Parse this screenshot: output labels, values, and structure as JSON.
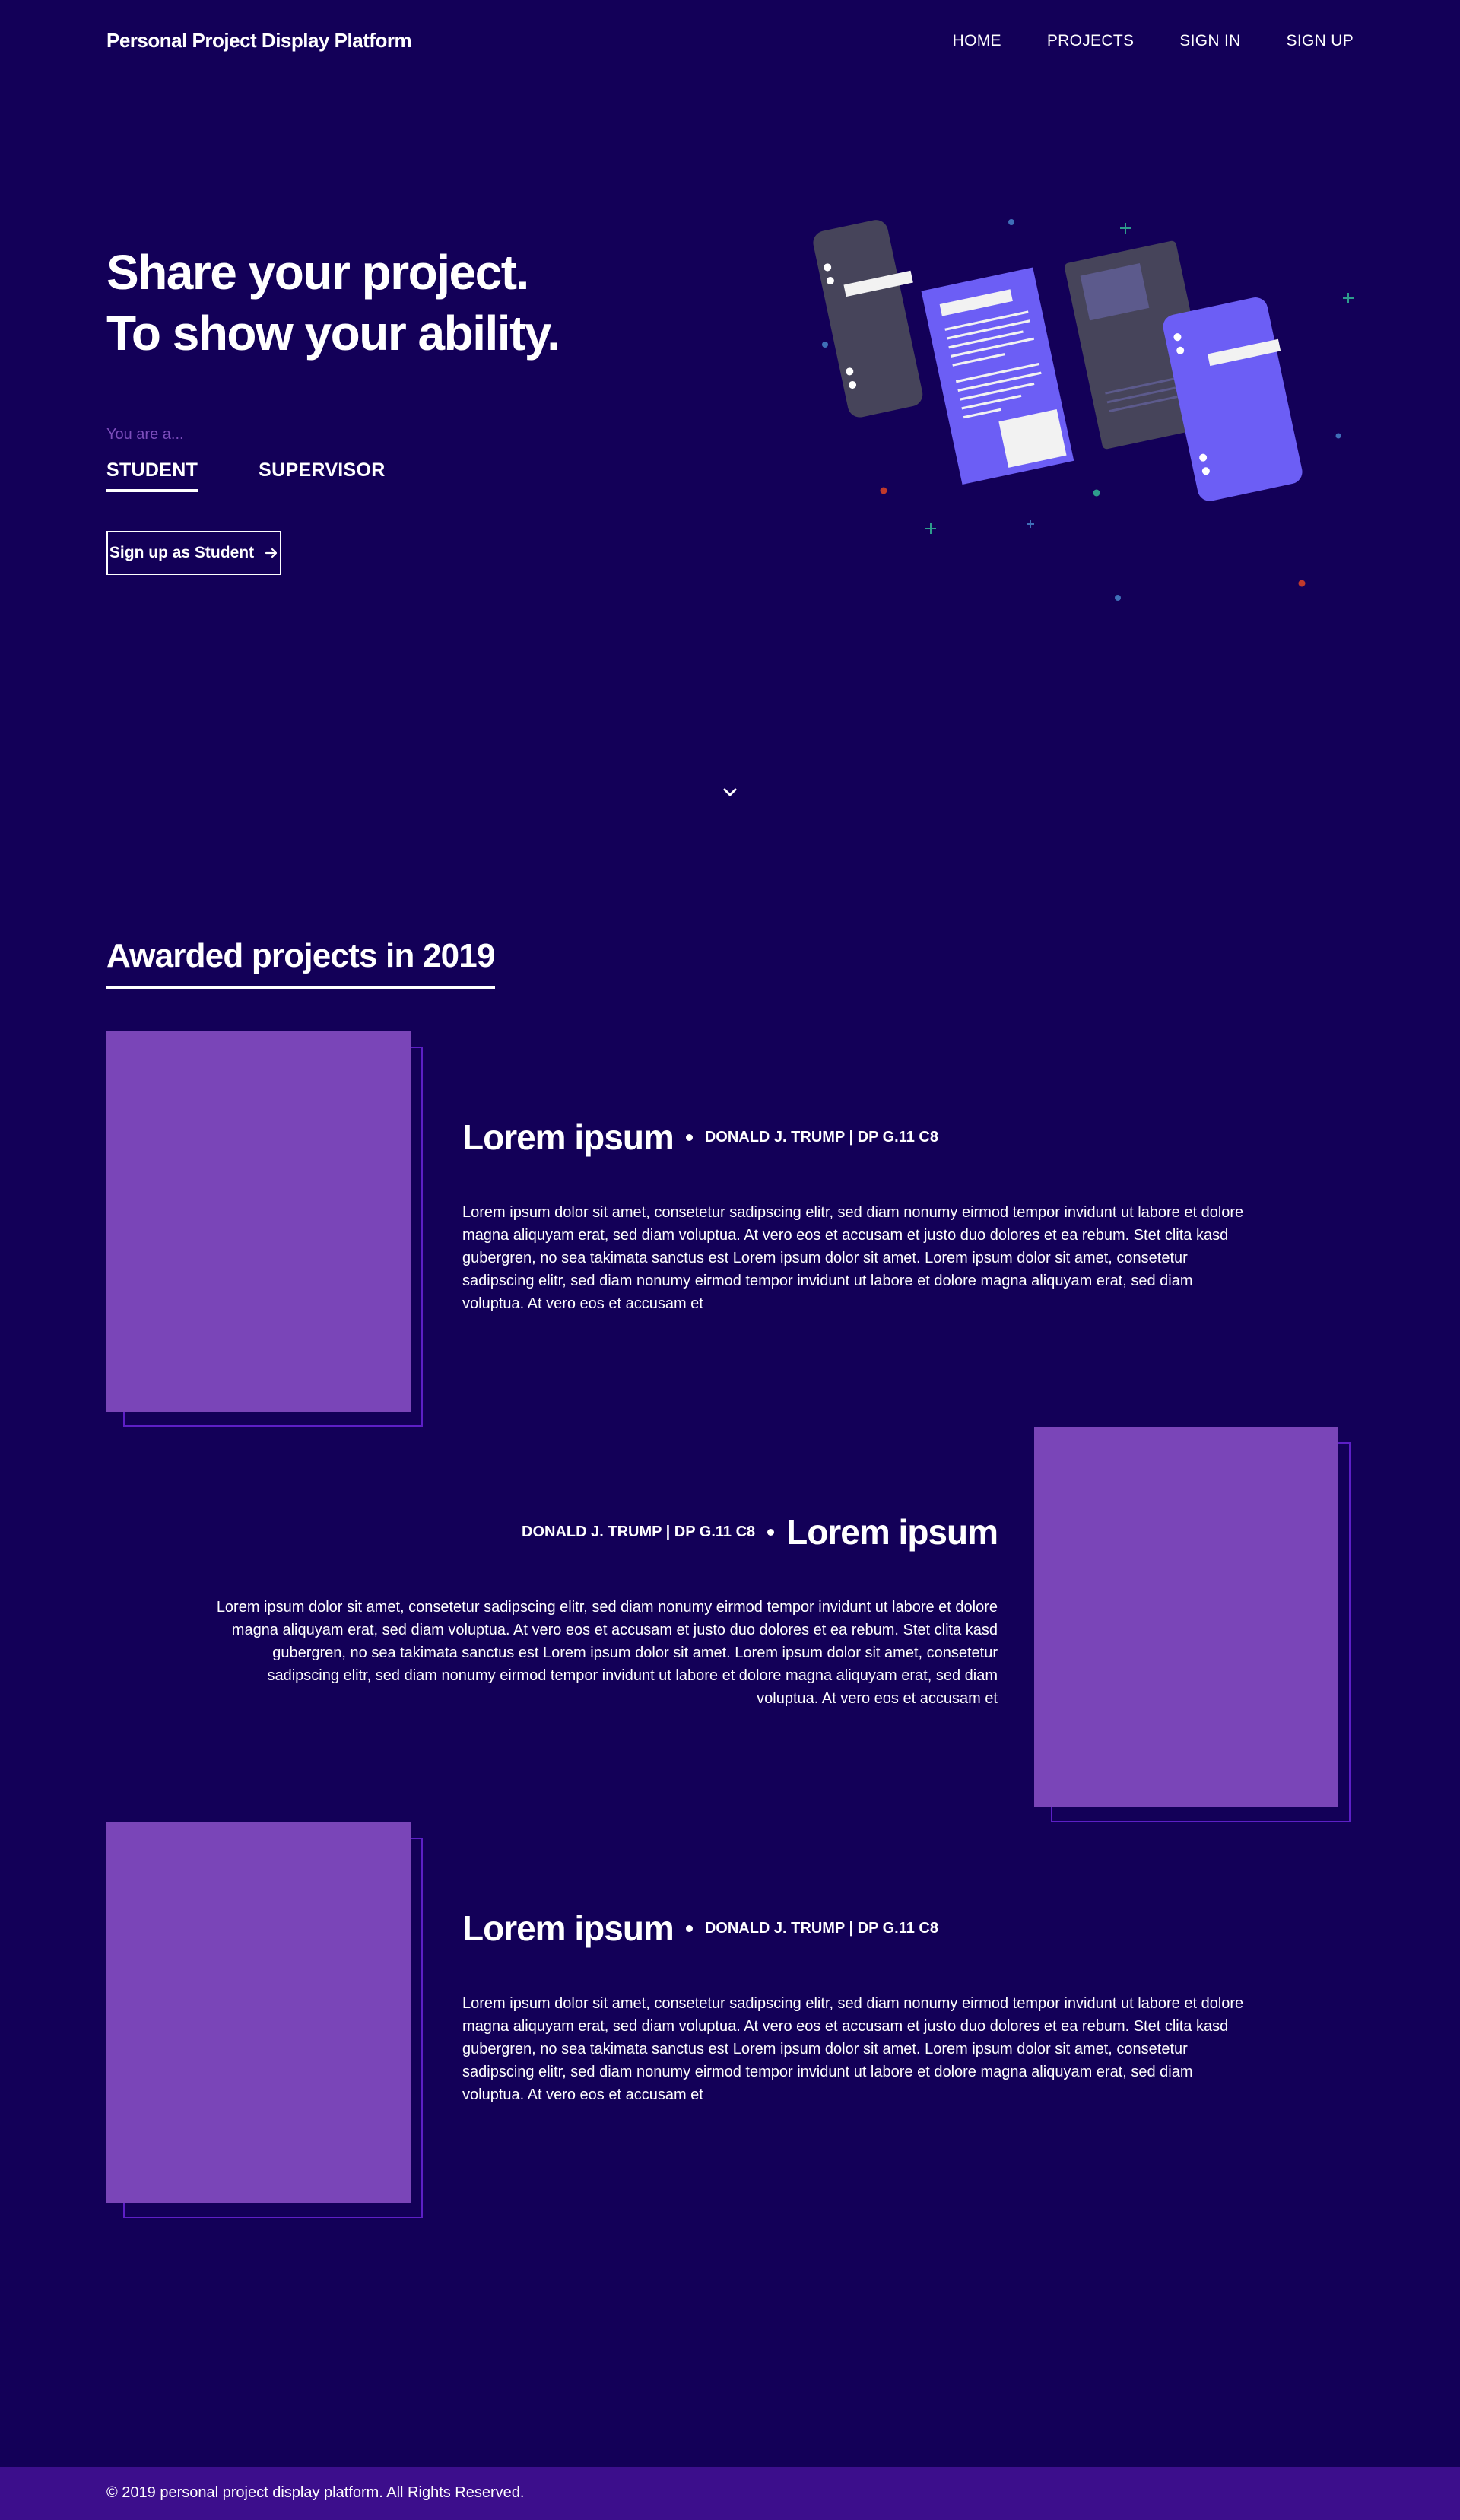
{
  "header": {
    "brand": "Personal Project Display Platform",
    "nav": [
      "HOME",
      "PROJECTS",
      "SIGN IN",
      "SIGN UP"
    ]
  },
  "hero": {
    "title_line1": "Share your project.",
    "title_line2": "To show your ability.",
    "you_are": "You are a...",
    "roles": [
      "STUDENT",
      "SUPERVISOR"
    ],
    "active_role": "STUDENT",
    "cta": "Sign up as Student"
  },
  "awarded": {
    "title": "Awarded projects in 2019",
    "projects": [
      {
        "title": "Lorem ipsum",
        "meta": "DONALD J. TRUMP | DP G.11 C8",
        "description": "Lorem ipsum dolor sit amet, consetetur sadipscing elitr, sed diam nonumy eirmod tempor invidunt ut labore et dolore magna aliquyam erat, sed diam voluptua. At vero eos et accusam et justo duo dolores et ea rebum. Stet clita kasd gubergren, no sea takimata sanctus est Lorem ipsum dolor sit amet. Lorem ipsum dolor sit amet, consetetur sadipscing elitr, sed diam nonumy eirmod tempor invidunt ut labore et dolore magna aliquyam erat, sed diam voluptua. At vero eos et accusam et"
      },
      {
        "title": "Lorem ipsum",
        "meta": "DONALD J. TRUMP | DP G.11 C8",
        "description": "Lorem ipsum dolor sit amet, consetetur sadipscing elitr, sed diam nonumy eirmod tempor invidunt ut labore et dolore magna aliquyam erat, sed diam voluptua. At vero eos et accusam et justo duo dolores et ea rebum. Stet clita kasd gubergren, no sea takimata sanctus est Lorem ipsum dolor sit amet. Lorem ipsum dolor sit amet, consetetur sadipscing elitr, sed diam nonumy eirmod tempor invidunt ut labore et dolore magna aliquyam erat, sed diam voluptua. At vero eos et accusam et"
      },
      {
        "title": "Lorem ipsum",
        "meta": "DONALD J. TRUMP | DP G.11 C8",
        "description": "Lorem ipsum dolor sit amet, consetetur sadipscing elitr, sed diam nonumy eirmod tempor invidunt ut labore et dolore magna aliquyam erat, sed diam voluptua. At vero eos et accusam et justo duo dolores et ea rebum. Stet clita kasd gubergren, no sea takimata sanctus est Lorem ipsum dolor sit amet. Lorem ipsum dolor sit amet, consetetur sadipscing elitr, sed diam nonumy eirmod tempor invidunt ut labore et dolore magna aliquyam erat, sed diam voluptua. At vero eos et accusam et"
      }
    ]
  },
  "footer": {
    "copyright": "© 2019 personal project display platform. All Rights Reserved."
  },
  "colors": {
    "background": "#130058",
    "accent_purple": "#7a45b8",
    "card_outline": "#5d1fc6",
    "illustration_blue": "#6c5ef5",
    "illustration_grey": "#46445a",
    "footer": "#3c0e8c"
  },
  "icons": {
    "cta_arrow": "arrow-right-icon",
    "scroll": "chevron-down-icon"
  }
}
